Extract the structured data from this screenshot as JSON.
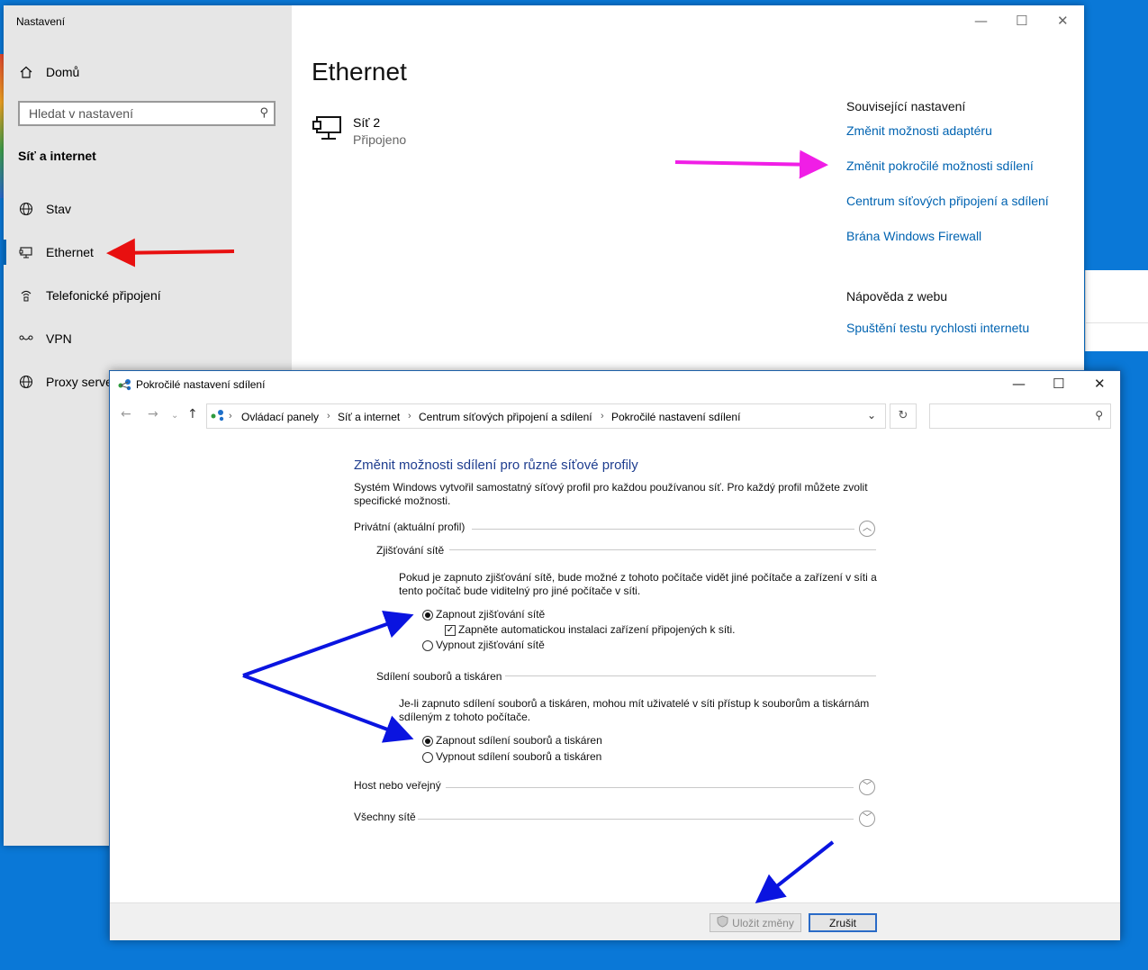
{
  "settings": {
    "window_title": "Nastavení",
    "sidebar": {
      "home_label": "Domů",
      "search_placeholder": "Hledat v nastavení",
      "section_title": "Síť a internet",
      "items": [
        {
          "label": "Stav",
          "icon": "globe-icon"
        },
        {
          "label": "Ethernet",
          "icon": "ethernet-icon"
        },
        {
          "label": "Telefonické připojení",
          "icon": "dialup-icon"
        },
        {
          "label": "VPN",
          "icon": "vpn-icon"
        },
        {
          "label": "Proxy serve",
          "icon": "globe-icon"
        }
      ]
    },
    "page_title": "Ethernet",
    "network": {
      "name": "Síť 2",
      "status": "Připojeno"
    },
    "related": {
      "heading": "Související nastavení",
      "links": [
        "Změnit možnosti adaptéru",
        "Změnit pokročilé možnosti sdílení",
        "Centrum síťových připojení a sdílení",
        "Brána Windows Firewall"
      ]
    },
    "help": {
      "heading": "Nápověda z webu",
      "link": "Spuštění testu rychlosti internetu"
    }
  },
  "control_panel": {
    "window_title": "Pokročilé nastavení sdílení",
    "breadcrumb": [
      "Ovládací panely",
      "Síť a internet",
      "Centrum síťových připojení a sdílení",
      "Pokročilé nastavení sdílení"
    ],
    "heading": "Změnit možnosti sdílení pro různé síťové profily",
    "intro_line1": "Systém Windows vytvořil samostatný síťový profil pro každou používanou síť. Pro každý profil můžete zvolit",
    "intro_line2": "specifické možnosti.",
    "private_profile": {
      "title": "Privátní (aktuální profil)",
      "discovery": {
        "title": "Zjišťování sítě",
        "desc_line1": "Pokud je zapnuto zjišťování sítě, bude možné z tohoto počítače vidět jiné počítače a zařízení v síti a",
        "desc_line2": "tento počítač bude viditelný pro jiné počítače v síti.",
        "on_label": "Zapnout zjišťování sítě",
        "auto_setup_label": "Zapněte automatickou instalaci zařízení připojených k síti.",
        "off_label": "Vypnout zjišťování sítě"
      },
      "sharing": {
        "title": "Sdílení souborů a tiskáren",
        "desc_line1": "Je-li zapnuto sdílení souborů a tiskáren, mohou mít uživatelé v síti přístup k souborům a tiskárnám",
        "desc_line2": "sdíleným z tohoto počítače.",
        "on_label": "Zapnout sdílení souborů a tiskáren",
        "off_label": "Vypnout sdílení souborů a tiskáren"
      }
    },
    "guest_profile": {
      "title": "Host nebo veřejný"
    },
    "all_networks": {
      "title": "Všechny sítě"
    },
    "buttons": {
      "save": "Uložit změny",
      "cancel": "Zrušit"
    }
  },
  "colors": {
    "link": "#0063b1",
    "heading_blue": "#1e3d8f",
    "arrow_red": "#e81010",
    "arrow_magenta": "#f01ee6",
    "arrow_blue": "#0a14e0",
    "desktop": "#0a78d7"
  }
}
